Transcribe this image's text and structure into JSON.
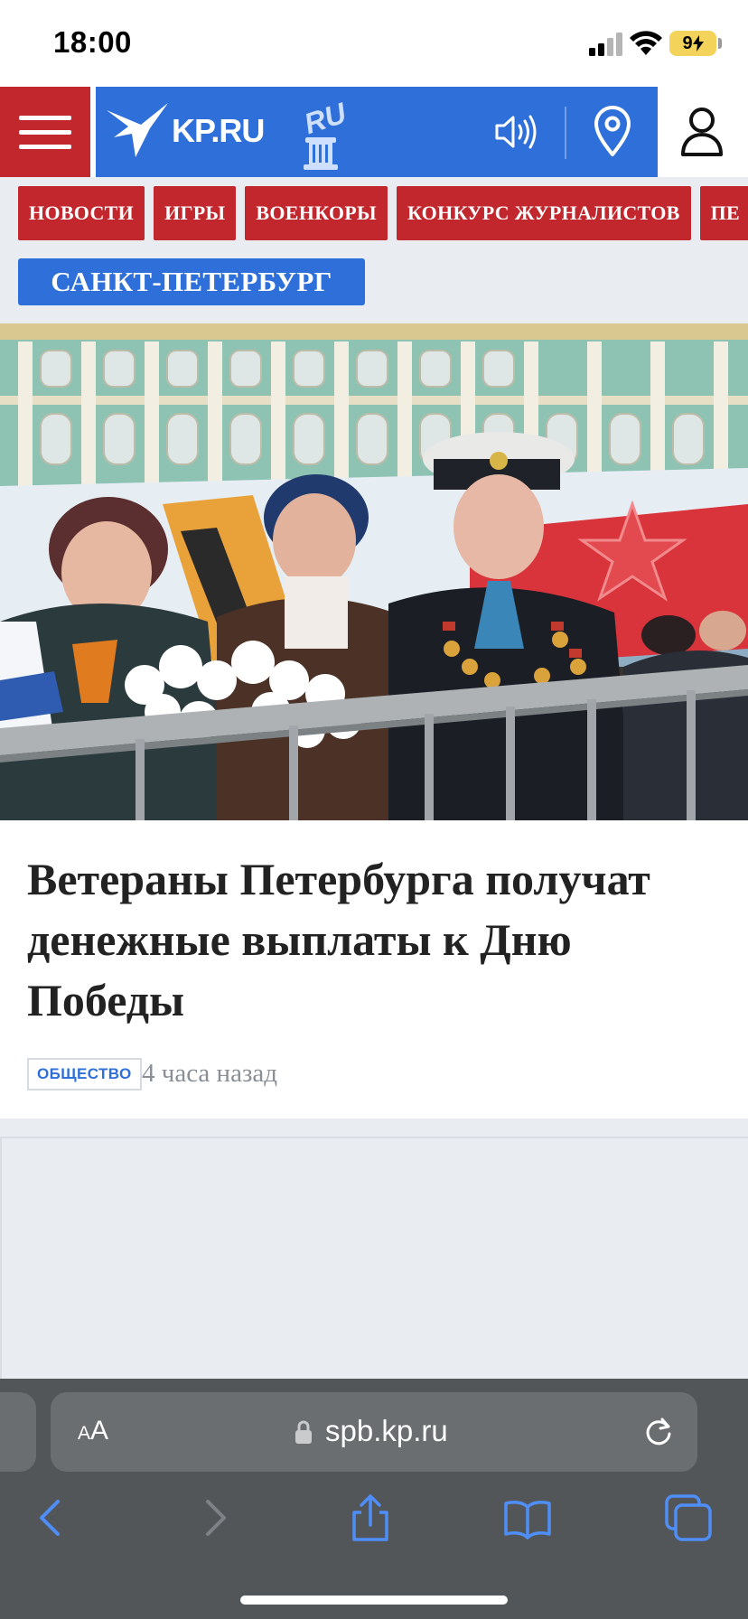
{
  "status_bar": {
    "time": "18:00",
    "battery": "9"
  },
  "header": {
    "logo_text": "KP.RU",
    "badge_text": "RU"
  },
  "nav": {
    "chips": [
      "НОВОСТИ",
      "ИГРЫ",
      "ВОЕНКОРЫ",
      "КОНКУРС ЖУРНАЛИСТОВ",
      "ПЕ"
    ],
    "region": "САНКТ-ПЕТЕРБУРГ"
  },
  "article": {
    "headline": "Ветераны Петербурга получат денежные выплаты к Дню Победы",
    "tag": "ОБЩЕСТВО",
    "time_ago": "4 часа назад"
  },
  "browser": {
    "aa_small": "A",
    "aa_big": "A",
    "url": "spb.kp.ru"
  },
  "colors": {
    "accent_red": "#c1272d",
    "accent_blue": "#2e6fd9",
    "browser_bar": "#535659",
    "toolbar_icon": "#4f8ef7"
  },
  "icons": {
    "menu": "hamburger-icon",
    "sound": "speaker-icon",
    "location": "map-pin-icon",
    "profile": "user-icon",
    "lock": "lock-icon",
    "reload": "reload-icon",
    "back": "chevron-left-icon",
    "forward": "chevron-right-icon",
    "share": "share-icon",
    "bookmarks": "book-icon",
    "tabs": "tabs-icon"
  }
}
